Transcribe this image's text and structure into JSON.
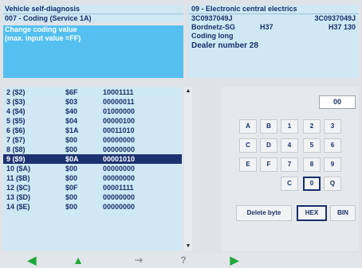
{
  "header": {
    "title": "Vehicle self-diagnosis",
    "subtitle": "007 - Coding (Service 1A)",
    "info_line1": "Change coding value",
    "info_line2": "(max. input value =FF)"
  },
  "module": {
    "name": "09 - Electronic central electrics",
    "part_left": "3C0937049J",
    "part_right": "3C0937049J",
    "component": "Bordnetz-SG",
    "hw": "H37",
    "hw_right": "H37 130",
    "coding_label": "Coding long",
    "dealer": "Dealer number 28"
  },
  "bytes": [
    {
      "index": "2 ($2)",
      "hex": "$6F",
      "bin": "10001111",
      "selected": false
    },
    {
      "index": "3 ($3)",
      "hex": "$03",
      "bin": "00000011",
      "selected": false
    },
    {
      "index": "4 ($4)",
      "hex": "$40",
      "bin": "01000000",
      "selected": false
    },
    {
      "index": "5 ($5)",
      "hex": "$04",
      "bin": "00000100",
      "selected": false
    },
    {
      "index": "6 ($6)",
      "hex": "$1A",
      "bin": "00011010",
      "selected": false
    },
    {
      "index": "7 ($7)",
      "hex": "$00",
      "bin": "00000000",
      "selected": false
    },
    {
      "index": "8 ($8)",
      "hex": "$00",
      "bin": "00000000",
      "selected": false
    },
    {
      "index": "9 ($9)",
      "hex": "$0A",
      "bin": "00001010",
      "selected": true
    },
    {
      "index": "10 ($A)",
      "hex": "$00",
      "bin": "00000000",
      "selected": false
    },
    {
      "index": "11 ($B)",
      "hex": "$00",
      "bin": "00000000",
      "selected": false
    },
    {
      "index": "12 ($C)",
      "hex": "$0F",
      "bin": "00001111",
      "selected": false
    },
    {
      "index": "13 ($D)",
      "hex": "$00",
      "bin": "00000000",
      "selected": false
    },
    {
      "index": "14 ($E)",
      "hex": "$00",
      "bin": "00000000",
      "selected": false
    }
  ],
  "keypad": {
    "display_value": "00",
    "keys": [
      "A",
      "B",
      "1",
      "2",
      "3",
      "C",
      "D",
      "4",
      "5",
      "6",
      "E",
      "F",
      "7",
      "8",
      "9",
      "C",
      "0",
      "Q"
    ],
    "delete_label": "Delete byte",
    "hex_label": "HEX",
    "bin_label": "BIN"
  },
  "nav": {
    "back_icon": "arrow-left",
    "up_icon": "arrow-up",
    "mid1_label": "⇢",
    "mid2_label": "?",
    "forward_icon": "arrow-right"
  },
  "colors": {
    "accent": "#55c0ef",
    "selection": "#1b3170",
    "nav_green": "#1fa83a"
  }
}
